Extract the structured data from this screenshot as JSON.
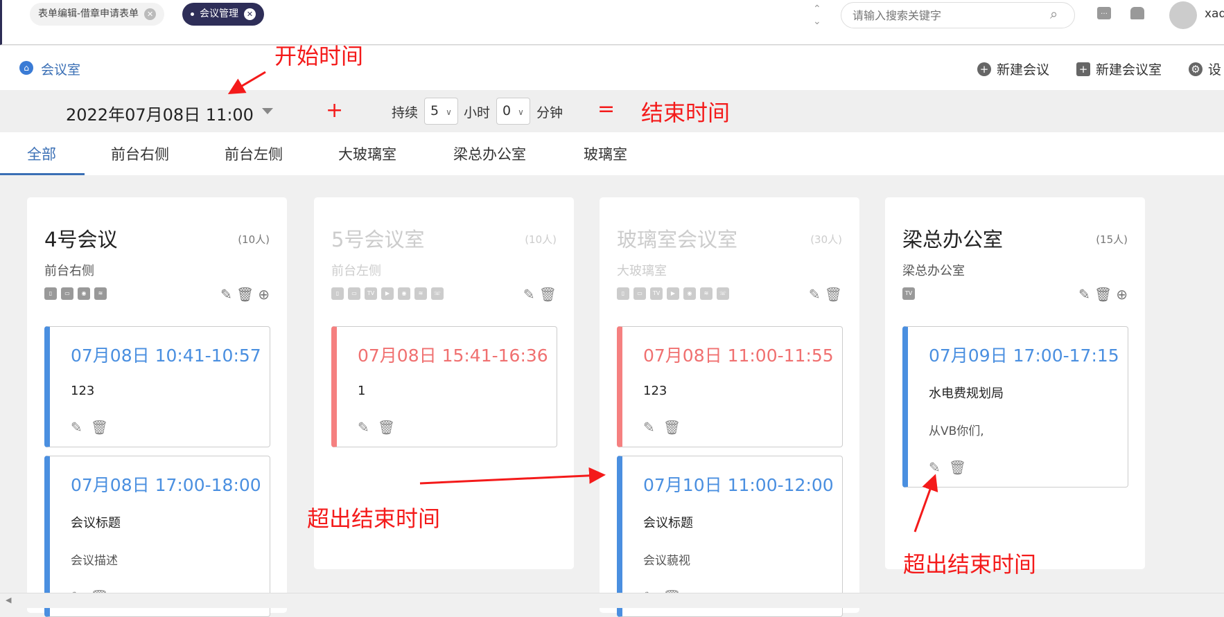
{
  "topbar": {
    "tabs": [
      {
        "label": "表单编辑-借章申请表单"
      },
      {
        "label": "会议管理"
      }
    ],
    "search_placeholder": "请输入搜索关键字",
    "user": "xad"
  },
  "breadcrumb": {
    "label": "会议室"
  },
  "actions": {
    "new_meeting": "新建会议",
    "new_room": "新建会议室",
    "settings": "设"
  },
  "filter": {
    "start": "2022年07月08日 11:00",
    "duration_label": "持续",
    "hours": "5",
    "hours_unit": "小时",
    "minutes": "0",
    "minutes_unit": "分钟"
  },
  "room_tabs": [
    "全部",
    "前台右侧",
    "前台左侧",
    "大玻璃室",
    "梁总办公室",
    "玻璃室"
  ],
  "rooms": [
    {
      "name": "4号会议",
      "capacity": "(10人)",
      "location": "前台右侧",
      "disabled": false,
      "facilities": [
        "whiteboard",
        "screen",
        "camera",
        "wifi"
      ],
      "can_add": true,
      "meetings": [
        {
          "time": "07月08日 10:41-10:57",
          "title": "123",
          "desc": "",
          "status": "normal"
        },
        {
          "time": "07月08日 17:00-18:00",
          "title": "会议标题",
          "desc": "会议描述",
          "status": "normal"
        }
      ]
    },
    {
      "name": "5号会议室",
      "capacity": "(10人)",
      "location": "前台左侧",
      "disabled": true,
      "facilities": [
        "whiteboard",
        "screen",
        "tv",
        "video",
        "camera",
        "wifi",
        "phone"
      ],
      "can_add": false,
      "meetings": [
        {
          "time": "07月08日 15:41-16:36",
          "title": "1",
          "desc": "",
          "status": "conflict"
        }
      ]
    },
    {
      "name": "玻璃室会议室",
      "capacity": "(30人)",
      "location": "大玻璃室",
      "disabled": true,
      "facilities": [
        "whiteboard",
        "screen",
        "tv",
        "video",
        "camera",
        "wifi",
        "phone"
      ],
      "can_add": false,
      "meetings": [
        {
          "time": "07月08日 11:00-11:55",
          "title": "123",
          "desc": "",
          "status": "conflict"
        },
        {
          "time": "07月10日 11:00-12:00",
          "title": "会议标题",
          "desc": "会议藐视",
          "status": "normal"
        }
      ]
    },
    {
      "name": "梁总办公室",
      "capacity": "(15人)",
      "location": "梁总办公室",
      "disabled": false,
      "facilities": [
        "tv"
      ],
      "can_add": true,
      "meetings": [
        {
          "time": "07月09日 17:00-17:15",
          "title": "水电费规划局",
          "desc": "从VB你们,",
          "status": "normal"
        }
      ]
    }
  ],
  "annotations": {
    "start": "开始时间",
    "plus": "+",
    "equals": "=",
    "end": "结束时间",
    "exceed1": "超出结束时间",
    "exceed2": "超出结束时间"
  },
  "colors": {
    "accent": "#4a8fe0",
    "conflict": "#f07070",
    "annotation": "#f41a1a",
    "active_tab": "#2e2e58"
  }
}
